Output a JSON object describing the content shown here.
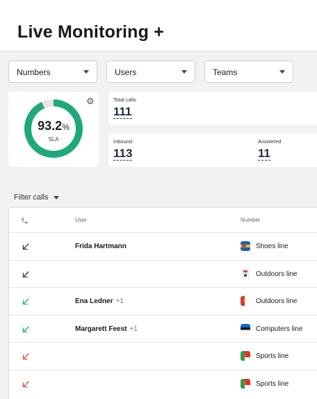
{
  "header": {
    "title": "Live Monitoring +"
  },
  "filters": {
    "numbers": "Numbers",
    "users": "Users",
    "teams": "Teams"
  },
  "gauge": {
    "value": "93.2",
    "unit": "%",
    "label": "SLA",
    "fraction": 0.932,
    "color": "#1ea97c"
  },
  "stats": {
    "total_calls_label": "Total calls",
    "total_calls": "111",
    "inbound_label": "Inbound",
    "inbound": "113",
    "answered_label": "Answered",
    "answered": "11"
  },
  "filter_calls": "Filter calls",
  "table": {
    "headers": {
      "user": "User",
      "number": "Number"
    },
    "rows": [
      {
        "direction": "inbound-missed",
        "user": "Frida Hartmann",
        "extra": "",
        "number": "Shoes line",
        "flag": "shoes-flag-icon"
      },
      {
        "direction": "inbound-missed",
        "user": "",
        "extra": "",
        "number": "Outdoors line",
        "flag": "outdoors-flag-icon"
      },
      {
        "direction": "inbound-answered",
        "user": "Ena Ledner",
        "extra": "+1",
        "number": "Outdoors line",
        "flag": "outdoors-red-flag-icon"
      },
      {
        "direction": "inbound-answered",
        "user": "Margarett Feest",
        "extra": "+1",
        "number": "Computers line",
        "flag": "computers-flag-icon"
      },
      {
        "direction": "inbound-failed",
        "user": "",
        "extra": "",
        "number": "Sports line",
        "flag": "sports-flag-icon"
      },
      {
        "direction": "inbound-failed",
        "user": "",
        "extra": "",
        "number": "Sports line",
        "flag": "sports-flag-icon"
      }
    ]
  },
  "colors": {
    "accent": "#1ea97c",
    "missed": "#333333",
    "answered": "#1ea97c",
    "failed": "#e0452f"
  }
}
